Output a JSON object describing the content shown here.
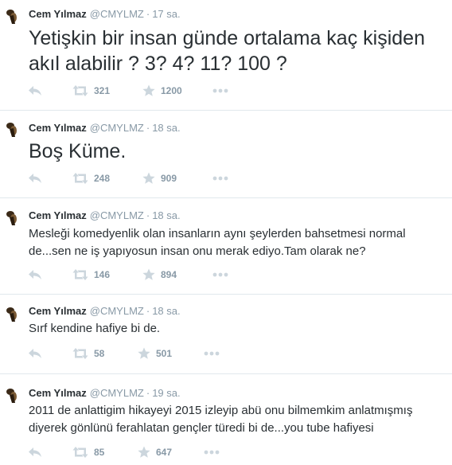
{
  "tweets": [
    {
      "name": "Cem Yılmaz",
      "handle": "@CMYLMZ",
      "separator": "·",
      "time": "17 sa.",
      "text": "Yetişkin bir insan günde ortalama kaç kişiden akıl alabilir ? 3? 4? 11? 100 ?",
      "text_size": "big",
      "retweets": "321",
      "favorites": "1200"
    },
    {
      "name": "Cem Yılmaz",
      "handle": "@CMYLMZ",
      "separator": "·",
      "time": "18 sa.",
      "text": "Boş Küme.",
      "text_size": "big",
      "retweets": "248",
      "favorites": "909"
    },
    {
      "name": "Cem Yılmaz",
      "handle": "@CMYLMZ",
      "separator": "·",
      "time": "18 sa.",
      "text": "Mesleği komedyenlik olan insanların aynı şeylerden bahsetmesi normal de...sen ne iş yapıyosun insan onu merak ediyo.Tam olarak ne?",
      "text_size": "normal",
      "retweets": "146",
      "favorites": "894"
    },
    {
      "name": "Cem Yılmaz",
      "handle": "@CMYLMZ",
      "separator": "·",
      "time": "18 sa.",
      "text": "Sırf kendine hafiye bi de.",
      "text_size": "normal",
      "retweets": "58",
      "favorites": "501"
    },
    {
      "name": "Cem Yılmaz",
      "handle": "@CMYLMZ",
      "separator": "·",
      "time": "19 sa.",
      "text": "2011 de anlattigim hikayeyi 2015 izleyip abü onu bilmemkim anlatmışmış diyerek gönlünü ferahlatan gençler türedi bi de...you tube hafiyesi",
      "text_size": "normal",
      "retweets": "85",
      "favorites": "647"
    }
  ],
  "icons": {
    "reply": "reply-icon",
    "retweet": "retweet-icon",
    "favorite": "star-icon",
    "more": "more-dots-icon"
  },
  "colors": {
    "text": "#292f33",
    "muted": "#8899a6",
    "icon": "#ccd6dd",
    "divider": "#e1e8ed"
  }
}
